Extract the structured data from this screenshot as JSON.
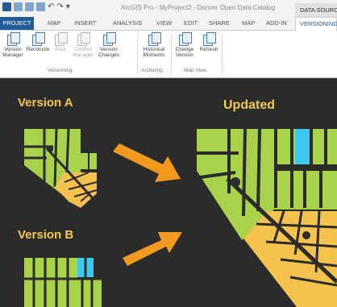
{
  "app": {
    "title": "ArcGIS Pro - MyProject2 - Denver Open Data Catalog",
    "context_tab": "DATA SOURCE"
  },
  "tabs": [
    {
      "label": "PROJECT"
    },
    {
      "label": "MAP"
    },
    {
      "label": "INSERT"
    },
    {
      "label": "ANALYSIS"
    },
    {
      "label": "VIEW"
    },
    {
      "label": "EDIT"
    },
    {
      "label": "SHARE"
    },
    {
      "label": "MAP"
    },
    {
      "label": "ADD-IN"
    },
    {
      "label": "VERSIONING"
    }
  ],
  "ribbon": {
    "buttons": [
      {
        "label": "Version\nManager",
        "enabled": true
      },
      {
        "label": "Reconcile",
        "enabled": true
      },
      {
        "label": "Post",
        "enabled": false
      },
      {
        "label": "Conflict\nManager",
        "enabled": false
      },
      {
        "label": "Version\nChanges",
        "enabled": true
      },
      {
        "label": "Historical\nMoments",
        "enabled": true
      },
      {
        "label": "Change\nVersion",
        "enabled": true
      },
      {
        "label": "Refresh",
        "enabled": true
      }
    ],
    "groups": [
      {
        "label": "Versioning"
      },
      {
        "label": "Archiving"
      },
      {
        "label": "Map View"
      }
    ]
  },
  "diagram": {
    "version_a_label": "Version A",
    "version_b_label": "Version B",
    "updated_label": "Updated",
    "colors": {
      "background": "#2b2b2b",
      "label": "#f2c94c",
      "parcel_green": "#a7d24a",
      "parcel_orange": "#f6c24e",
      "parcel_cyan": "#3ec9f0",
      "arrow": "#f39a1e",
      "road": "#2b2b2b"
    }
  }
}
